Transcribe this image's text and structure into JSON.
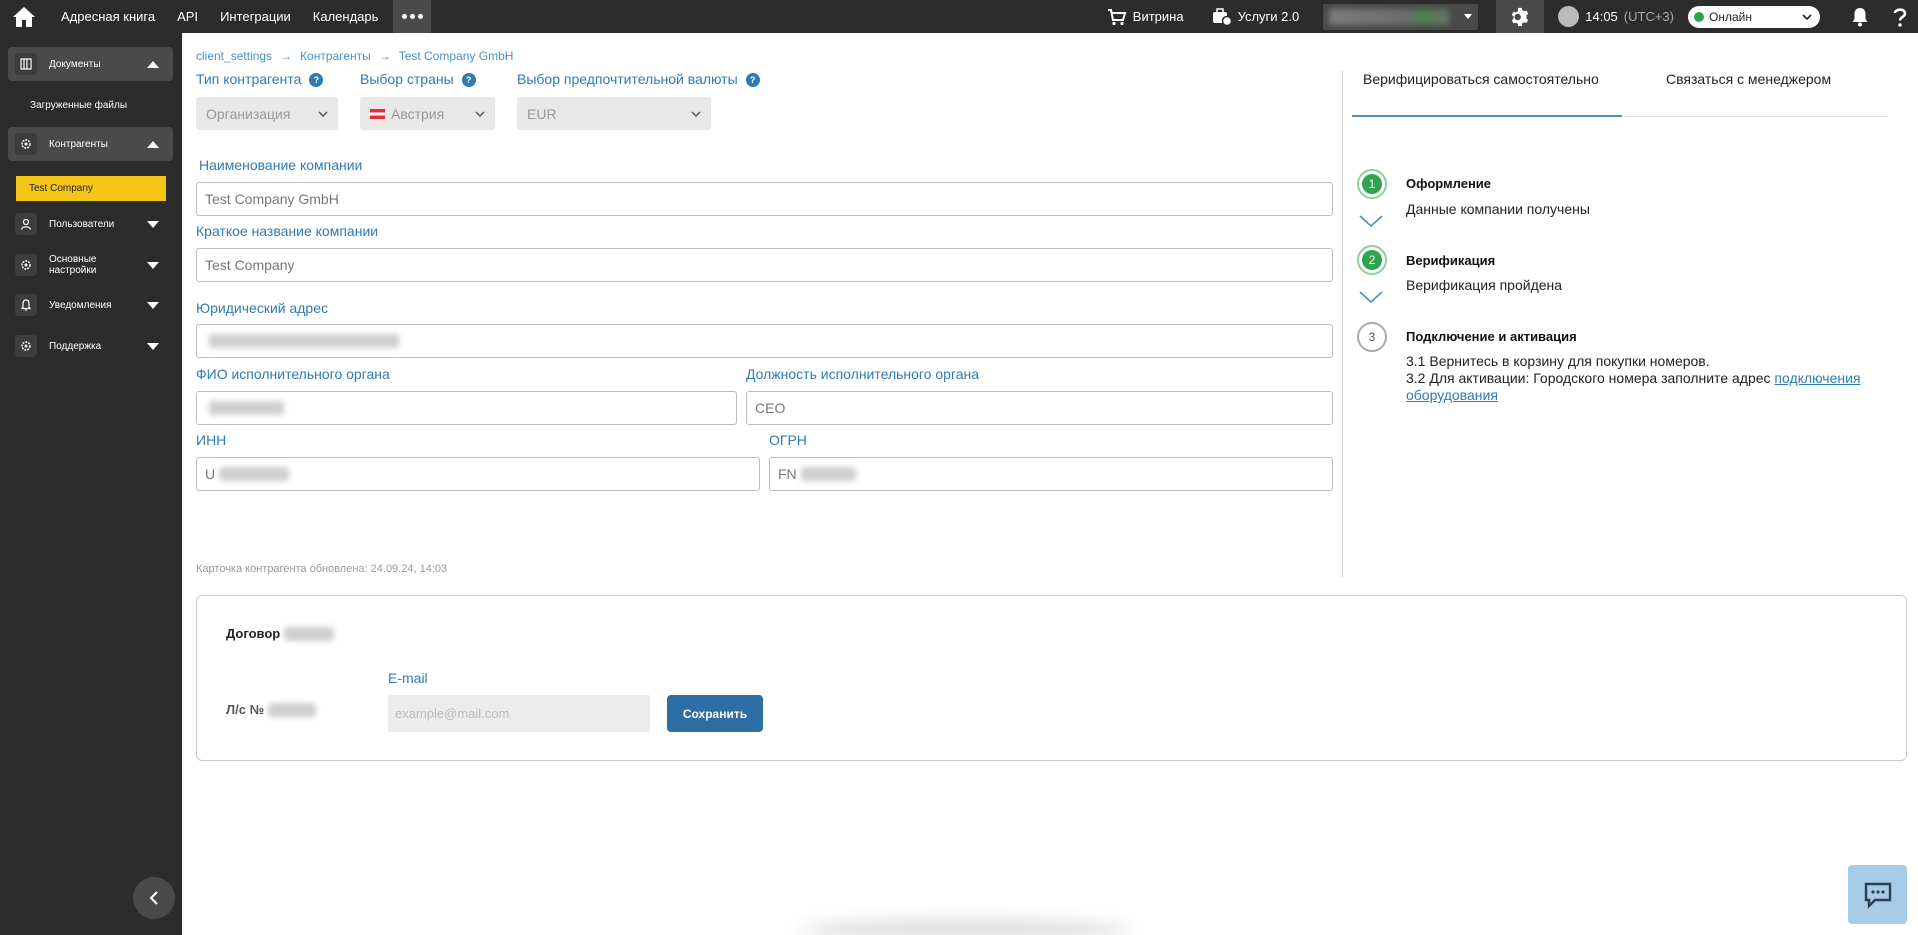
{
  "topbar": {
    "nav": [
      "Адресная книга",
      "API",
      "Интеграции",
      "Календарь"
    ],
    "showcase": "Витрина",
    "services": "Услуги 2.0",
    "time": "14:05",
    "timezone": "(UTC+3)",
    "status": "Онлайн"
  },
  "sidebar": {
    "documents": "Документы",
    "uploaded_files": "Загруженные файлы",
    "counterparties": "Контрагенты",
    "company": "Test Company",
    "users": "Пользователи",
    "main_settings_1": "Основные",
    "main_settings_2": "настройки",
    "notifications": "Уведомления",
    "support": "Поддержка"
  },
  "breadcrumb": [
    "client_settings",
    "Контрагенты",
    "Test Company GmbH"
  ],
  "form": {
    "counterparty_type_label": "Тип контрагента",
    "counterparty_type": "Организация",
    "country_label": "Выбор страны",
    "country": "Австрия",
    "currency_label": "Выбор предпочтительной валюты",
    "currency": "EUR",
    "company_name_label": "Наименование компании",
    "company_name": "Test Company GmbH",
    "short_name_label": "Краткое название компании",
    "short_name": "Test Company",
    "legal_address_label": "Юридический адрес",
    "executive_name_label": "ФИО исполнительного органа",
    "executive_position_label": "Должность исполнительного органа",
    "executive_position": "CEO",
    "inn_label": "ИНН",
    "inn_prefix": "U",
    "ogrn_label": "ОГРН",
    "ogrn_prefix": "FN",
    "updated": "Карточка контрагента обновлена: 24.09.24, 14:03"
  },
  "verification": {
    "tab_self": "Верифицироваться самостоятельно",
    "tab_manager": "Связаться с менеджером",
    "steps": [
      {
        "num": "1",
        "title": "Оформление",
        "desc": "Данные компании получены"
      },
      {
        "num": "2",
        "title": "Верификация",
        "desc": "Верификация пройдена"
      },
      {
        "num": "3",
        "title": "Подключение и активация"
      }
    ],
    "step3_line1": "3.1 Вернитесь в корзину для покупки номеров.",
    "step3_line2": "3.2 Для активации: Городского номера заполните адрес ",
    "step3_link": "подключения оборудования"
  },
  "contract": {
    "title": "Договор",
    "account": "Л/с №",
    "email_label": "E-mail",
    "email_placeholder": "example@mail.com",
    "save": "Сохранить"
  }
}
